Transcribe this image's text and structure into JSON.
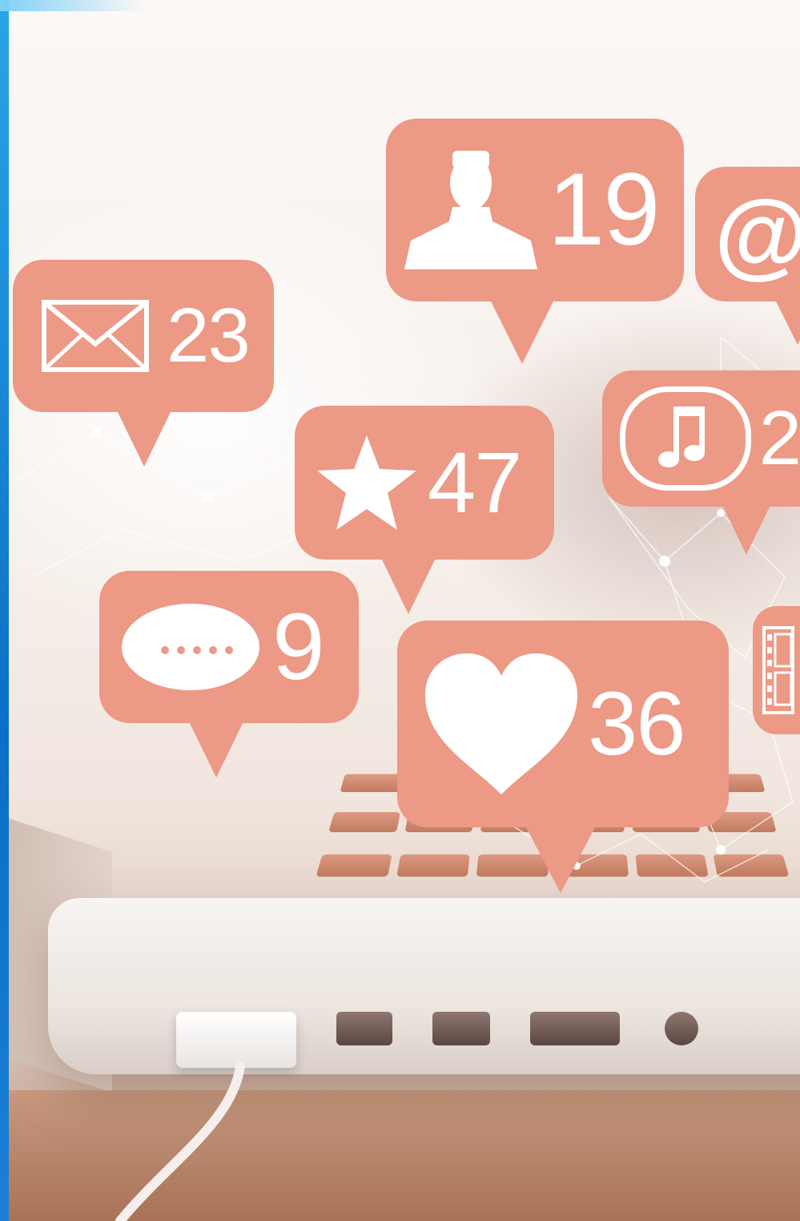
{
  "colors": {
    "bubble": "#ec9985",
    "bubble_text": "#ffffff",
    "accent_strip": "#0a6fc7"
  },
  "notifications": [
    {
      "icon": "envelope-icon",
      "count": "23"
    },
    {
      "icon": "user-icon",
      "count": "19"
    },
    {
      "icon": "at-sign-icon",
      "symbol": "@"
    },
    {
      "icon": "star-icon",
      "count": "47"
    },
    {
      "icon": "music-note-icon",
      "count": "2"
    },
    {
      "icon": "speech-bubble-icon",
      "count": "9"
    },
    {
      "icon": "heart-icon",
      "count": "36"
    },
    {
      "icon": "film-strip-icon"
    }
  ]
}
